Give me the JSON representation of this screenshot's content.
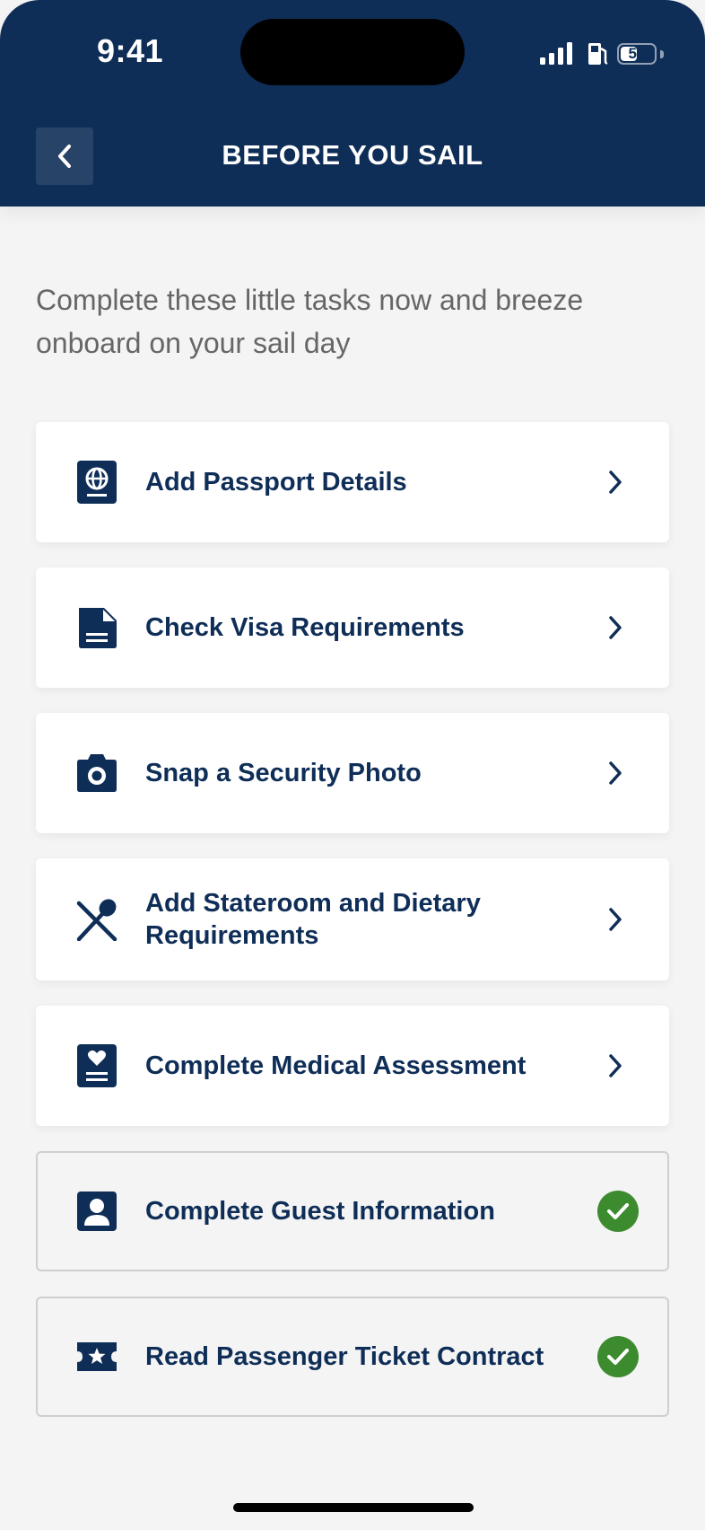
{
  "status_bar": {
    "time": "9:41",
    "battery_percent": 50,
    "battery_label": "50"
  },
  "header": {
    "title": "BEFORE YOU SAIL",
    "back_icon": "chevron-left-icon"
  },
  "intro_text": "Complete these little tasks now and breeze onboard on your sail day",
  "tasks": [
    {
      "label": "Add Passport Details",
      "icon": "passport-icon",
      "completed": false
    },
    {
      "label": "Check Visa Requirements",
      "icon": "document-icon",
      "completed": false
    },
    {
      "label": "Snap a Security Photo",
      "icon": "camera-icon",
      "completed": false
    },
    {
      "label": "Add Stateroom and Dietary Requirements",
      "icon": "utensils-icon",
      "completed": false
    },
    {
      "label": "Complete Medical Assessment",
      "icon": "medical-heart-icon",
      "completed": false
    },
    {
      "label": "Complete Guest Information",
      "icon": "person-card-icon",
      "completed": true
    },
    {
      "label": "Read Passenger Ticket Contract",
      "icon": "ticket-icon",
      "completed": true
    }
  ],
  "colors": {
    "header_bg": "#0f2e57",
    "text_primary": "#0f2e57",
    "page_bg": "#f4f4f4",
    "success": "#3d8b2f"
  }
}
